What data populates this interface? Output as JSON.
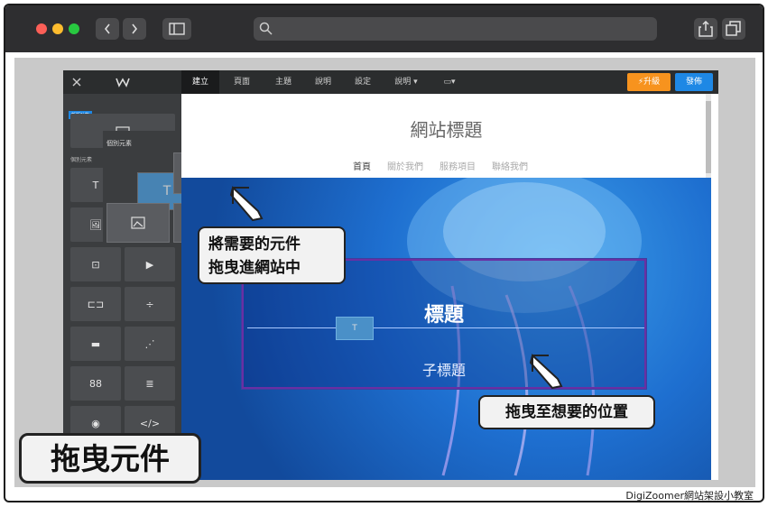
{
  "browser": {
    "dot_colors": [
      "#fc5f57",
      "#fdbc2e",
      "#28c840"
    ]
  },
  "editor_topbar": {
    "tabs": [
      "建立",
      "頁面",
      "主題",
      "說明",
      "設定",
      "說明 ▾",
      "▭▾"
    ],
    "upgrade_label": "⚡升級",
    "publish_label": "發佈",
    "upgrade_color": "#f7931e",
    "publish_color": "#1e88e5"
  },
  "sidebar": {
    "badge": "新版功能",
    "drag_popup_label": "個別元素",
    "section_label": "個別元素",
    "tiles": [
      {
        "glyph": "T"
      },
      {
        "glyph": "≡"
      },
      {
        "glyph": "🖼"
      },
      {
        "glyph": "⊞"
      },
      {
        "glyph": "⊡"
      },
      {
        "glyph": "▶"
      },
      {
        "glyph": "⊏⊐"
      },
      {
        "glyph": "÷"
      },
      {
        "glyph": "▬"
      },
      {
        "glyph": "⋰"
      },
      {
        "glyph": "88"
      },
      {
        "glyph": "≣"
      },
      {
        "glyph": "◉"
      },
      {
        "glyph": "</>"
      }
    ]
  },
  "site": {
    "title": "網站標題",
    "nav": [
      "首頁",
      "關於我們",
      "服務項目",
      "聯絡我們"
    ],
    "hero_heading": "標題",
    "hero_subheading": "子標題"
  },
  "annotations": {
    "callout_drag_line1": "將需要的元件",
    "callout_drag_line2": "拖曳進網站中",
    "callout_position": "拖曳至想要的位置",
    "big_label": "拖曳元件",
    "footer_credit": "DigiZoomer網站架設小教室"
  }
}
